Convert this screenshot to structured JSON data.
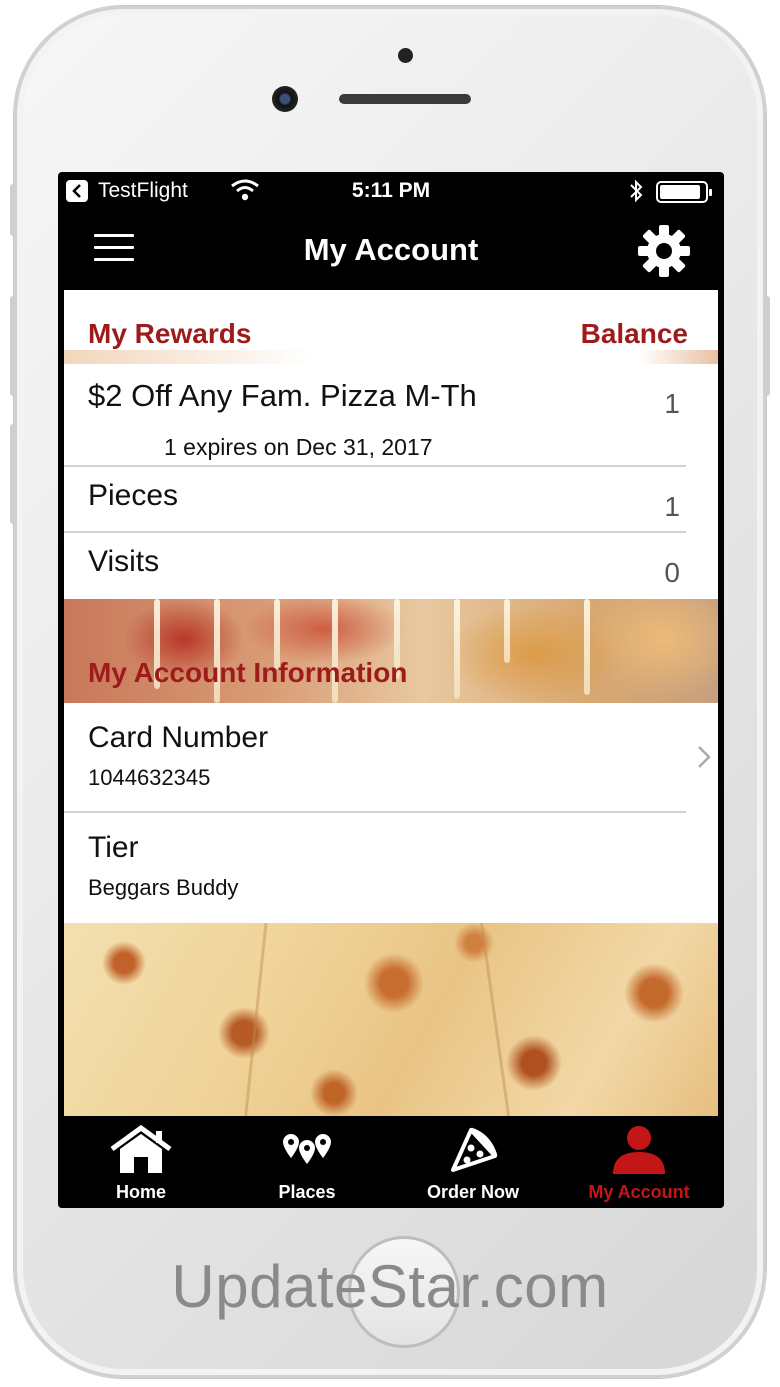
{
  "status_bar": {
    "back_app": "TestFlight",
    "time": "5:11 PM",
    "icons": [
      "back-arrow-icon",
      "wifi-icon",
      "bluetooth-icon",
      "battery-icon"
    ]
  },
  "nav": {
    "title": "My Account",
    "left_icon": "hamburger-menu-icon",
    "right_icon": "gear-icon"
  },
  "rewards": {
    "title": "My Rewards",
    "balance_label": "Balance",
    "items": [
      {
        "name": "$2 Off Any Fam. Pizza M-Th",
        "count": "1",
        "expires": "1 expires on Dec 31, 2017"
      }
    ],
    "stats": [
      {
        "label": "Pieces",
        "value": "1"
      },
      {
        "label": "Visits",
        "value": "0"
      }
    ]
  },
  "account_info": {
    "title": "My Account Information",
    "fields": [
      {
        "label": "Card Number",
        "value": "1044632345",
        "has_chevron": true
      },
      {
        "label": "Tier",
        "value": "Beggars Buddy",
        "has_chevron": false
      }
    ]
  },
  "tabs": [
    {
      "label": "Home",
      "icon": "house-icon",
      "active": false
    },
    {
      "label": "Places",
      "icon": "map-pins-icon",
      "active": false
    },
    {
      "label": "Order Now",
      "icon": "pizza-slice-icon",
      "active": false
    },
    {
      "label": "My Account",
      "icon": "user-icon",
      "active": true
    }
  ],
  "colors": {
    "accent_red": "#9e1b1b",
    "active_tab_red": "#c41616",
    "bar_black": "#000000"
  },
  "watermark": "UpdateStar.com"
}
